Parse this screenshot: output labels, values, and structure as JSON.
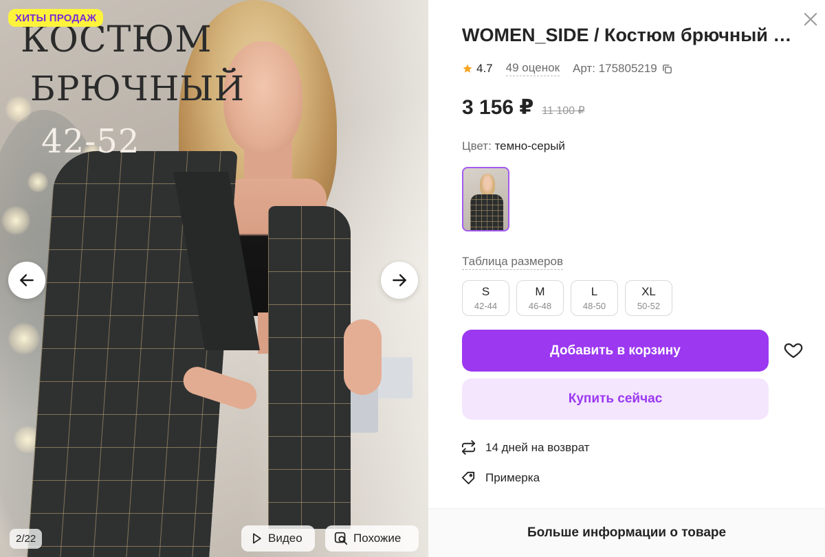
{
  "gallery": {
    "badge": "ХИТЫ ПРОДАЖ",
    "promo_line1": "КОСТЮМ",
    "promo_line2": "БРЮЧНЫЙ",
    "promo_line3": "42-52",
    "counter": "2/22",
    "video_label": "Видео",
    "similar_label": "Похожие",
    "icons": {
      "prev": "arrow-left-icon",
      "next": "arrow-right-icon",
      "video": "play-icon",
      "similar": "image-search-icon"
    }
  },
  "product": {
    "title": "WOMEN_SIDE / Костюм брючный классический",
    "rating": "4.7",
    "reviews": "49 оценок",
    "article": "Арт: 175805219",
    "price": "3 156 ₽",
    "old_price": "11 100 ₽",
    "color_label": "Цвет:",
    "color_value": "темно-серый",
    "size_table_label": "Таблица размеров",
    "sizes": [
      {
        "size": "S",
        "range": "42-44"
      },
      {
        "size": "M",
        "range": "46-48"
      },
      {
        "size": "L",
        "range": "48-50"
      },
      {
        "size": "XL",
        "range": "50-52"
      }
    ],
    "add_to_cart": "Добавить в корзину",
    "buy_now": "Купить сейчас",
    "return_policy": "14 дней на возврат",
    "fitting": "Примерка",
    "more_info": "Больше информации о товаре"
  },
  "colors": {
    "accent": "#9b38f0",
    "accent_light": "#f3e6fd",
    "badge_bg": "#fdf33b",
    "star": "#f5a623"
  }
}
